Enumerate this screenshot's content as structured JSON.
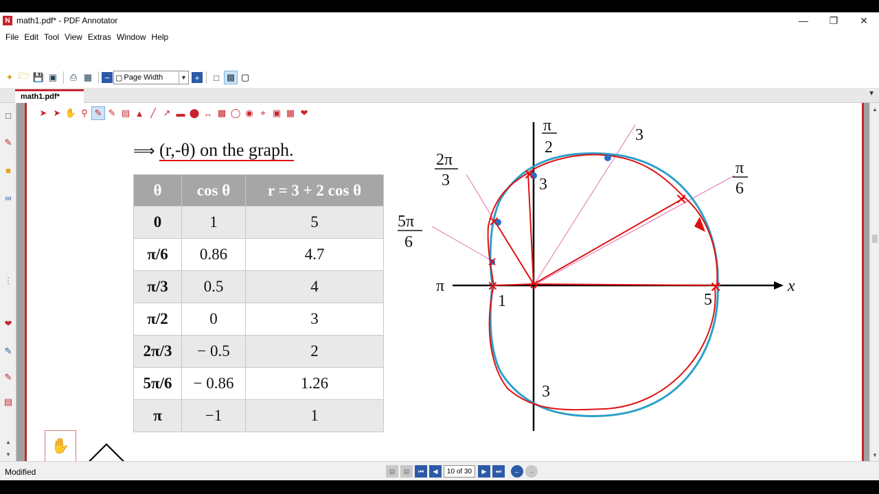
{
  "window": {
    "title": "math1.pdf* - PDF Annotator",
    "app_icon": "N"
  },
  "menu": [
    {
      "label": "File"
    },
    {
      "label": "Edit"
    },
    {
      "label": "Tool"
    },
    {
      "label": "View"
    },
    {
      "label": "Extras"
    },
    {
      "label": "Window"
    },
    {
      "label": "Help"
    }
  ],
  "toolbar": {
    "zoom_value": "Page Width"
  },
  "tabs": [
    {
      "label": "math1.pdf*"
    }
  ],
  "document": {
    "heading_arrow": "⟹",
    "heading_text": "(r,-θ) on the graph.",
    "table": {
      "headers": [
        "θ",
        "cos θ",
        "r = 3 + 2 cos θ"
      ],
      "rows": [
        [
          "0",
          "1",
          "5"
        ],
        [
          "π/6",
          "0.86",
          "4.7"
        ],
        [
          "π/3",
          "0.5",
          "4"
        ],
        [
          "π/2",
          "0",
          "3"
        ],
        [
          "2π/3",
          "− 0.5",
          "2"
        ],
        [
          "5π/6",
          "− 0.86",
          "1.26"
        ],
        [
          "π",
          "−1",
          "1"
        ]
      ]
    },
    "graph": {
      "labels": {
        "pi_half_num": "π",
        "pi_half_den": "2",
        "pi_third_top": "3",
        "two_pi_third_num": "2π",
        "two_pi_third_den": "3",
        "pi_sixth_num": "π",
        "pi_sixth_den": "6",
        "five_pi_sixth_num": "5π",
        "five_pi_sixth_den": "6",
        "pi": "π",
        "x": "x",
        "r_at_pi": "1",
        "r_at_zero": "5",
        "r_at_half_pi": "3",
        "r_at_three_half_pi": "3"
      },
      "colors": {
        "curve": "#2aa0c8",
        "ink": "#e01010",
        "rays": "#e070b0"
      }
    }
  },
  "status": {
    "left_text": "Modified",
    "page_indicator": "10 of 30"
  }
}
